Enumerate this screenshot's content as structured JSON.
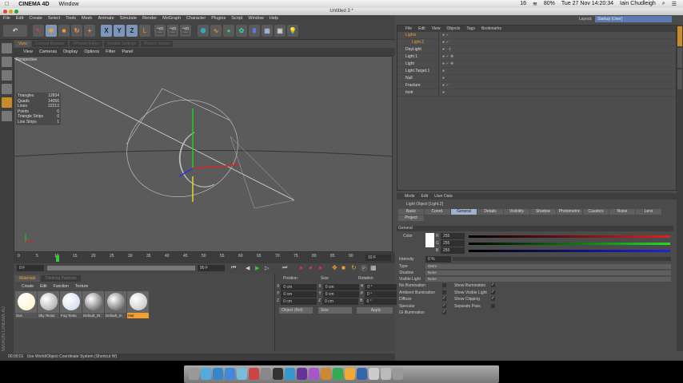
{
  "macbar": {
    "app": "CINEMA 4D",
    "menu": "Window",
    "badge": "16",
    "battery": "80%",
    "clock": "Tue 27 Nov  14:20:34",
    "user": "Iain Chudleigh"
  },
  "window": {
    "title": "Untitled 3 *"
  },
  "menu": [
    "File",
    "Edit",
    "Create",
    "Select",
    "Tools",
    "Mesh",
    "Animate",
    "Simulate",
    "Render",
    "MoGraph",
    "Character",
    "Plugins",
    "Script",
    "Window",
    "Help"
  ],
  "toolbar": {
    "x": "X",
    "y": "Y",
    "z": "Z"
  },
  "viewport": {
    "tabs": [
      "View",
      "Content Browser",
      "XPresso Editor",
      "Render Settings",
      "Picture Viewer"
    ],
    "menu": [
      "View",
      "Cameras",
      "Display",
      "Options",
      "Filter",
      "Panel"
    ],
    "camera": "Perspective",
    "stats": [
      {
        "label": "Triangles",
        "value": "12834"
      },
      {
        "label": "Quads",
        "value": "14056"
      },
      {
        "label": "Lines",
        "value": "22212"
      },
      {
        "label": "Points",
        "value": "0"
      },
      {
        "label": "Triangle Strips",
        "value": "0"
      },
      {
        "label": "Line Strips",
        "value": "1"
      }
    ]
  },
  "timeline": {
    "ticks": [
      "0",
      "5",
      "10",
      "15",
      "20",
      "25",
      "30",
      "35",
      "40",
      "45",
      "50",
      "55",
      "60",
      "65",
      "70",
      "75",
      "80",
      "85",
      "90"
    ],
    "current": "10 F",
    "start": "0 F",
    "end": "90 F",
    "playhead_frame": 10
  },
  "materials": {
    "tabs": [
      "Materials",
      "Thinking Particles"
    ],
    "menu": [
      "Create",
      "Edit",
      "Function",
      "Texture"
    ],
    "items": [
      {
        "name": "Sun",
        "color": "#fff3c0"
      },
      {
        "name": "Sky Textur",
        "color": "#9a9a9a"
      },
      {
        "name": "Fog Textu",
        "color": "#c8d4ea"
      },
      {
        "name": "Default_Ot",
        "color": "#444"
      },
      {
        "name": "Default_In",
        "color": "#444"
      },
      {
        "name": "Mat",
        "color": "#bbb"
      }
    ]
  },
  "coords": {
    "headers": [
      "Position",
      "Size",
      "Rotation"
    ],
    "rows": [
      {
        "a": "X",
        "p": "0 cm",
        "b": "X",
        "s": "0 cm",
        "c": "H",
        "r": "0 °"
      },
      {
        "a": "Y",
        "p": "0 cm",
        "b": "Y",
        "s": "0 cm",
        "c": "P",
        "r": "0 °"
      },
      {
        "a": "Z",
        "p": "0 cm",
        "b": "Z",
        "s": "0 cm",
        "c": "B",
        "r": "0 °"
      }
    ],
    "mode": "Object (Rel)",
    "size_mode": "Size",
    "apply": "Apply"
  },
  "status": {
    "time": "00:00:01",
    "text": "Use World/Object Coordinate System (Shortcut W)"
  },
  "layout": {
    "label": "Layout:",
    "value": "Startup (User)"
  },
  "objects": {
    "menu": [
      "File",
      "Edit",
      "View",
      "Objects",
      "Tags",
      "Bookmarks"
    ],
    "items": [
      {
        "name": "Lights",
        "tags": "● ✓"
      },
      {
        "name": "Light.2",
        "tags": "● ✓"
      },
      {
        "name": "DayLight",
        "tags": "● ·  ┼"
      },
      {
        "name": "Light.1",
        "tags": "● ✓ ✥"
      },
      {
        "name": "Light",
        "tags": "● ✓ ✥"
      },
      {
        "name": "Light.Target.1",
        "tags": "●"
      },
      {
        "name": "Null",
        "tags": "●"
      },
      {
        "name": "Fracture",
        "tags": "● ✓"
      },
      {
        "name": "Instr",
        "tags": "●"
      }
    ]
  },
  "attributes": {
    "menu": [
      "Mode",
      "Edit",
      "User Data"
    ],
    "title": "Light Object [Light.2]",
    "tabs": [
      "Basic",
      "Coord.",
      "General",
      "Details",
      "Visibility",
      "Shadow",
      "Photometric",
      "Caustics",
      "Noise",
      "Lens",
      "Project"
    ],
    "section": "General",
    "color_label": "Color",
    "r": "255",
    "g": "255",
    "b": "255",
    "r_label": "R",
    "g_label": "G",
    "b_label": "B",
    "intensity_label": "Intensity",
    "intensity": "0 %",
    "intensity_fraction": 0,
    "type_label": "Type",
    "type": "Omni",
    "shadow_label": "Shadow",
    "shadow": "None",
    "visible_label": "Visible Light",
    "visible": "None",
    "checks_left": [
      {
        "label": "No Illumination",
        "on": false
      },
      {
        "label": "Ambient Illumination",
        "on": false
      },
      {
        "label": "Diffuse",
        "on": true
      },
      {
        "label": "Specular",
        "on": true
      },
      {
        "label": "GI Illumination",
        "on": true
      }
    ],
    "checks_right": [
      {
        "label": "Show Illumination",
        "on": true
      },
      {
        "label": "Show Visible Light",
        "on": true
      },
      {
        "label": "Show Clipping",
        "on": true
      },
      {
        "label": "Separate Pass",
        "on": false
      }
    ]
  },
  "brand": "MAXON CINEMA 4D"
}
